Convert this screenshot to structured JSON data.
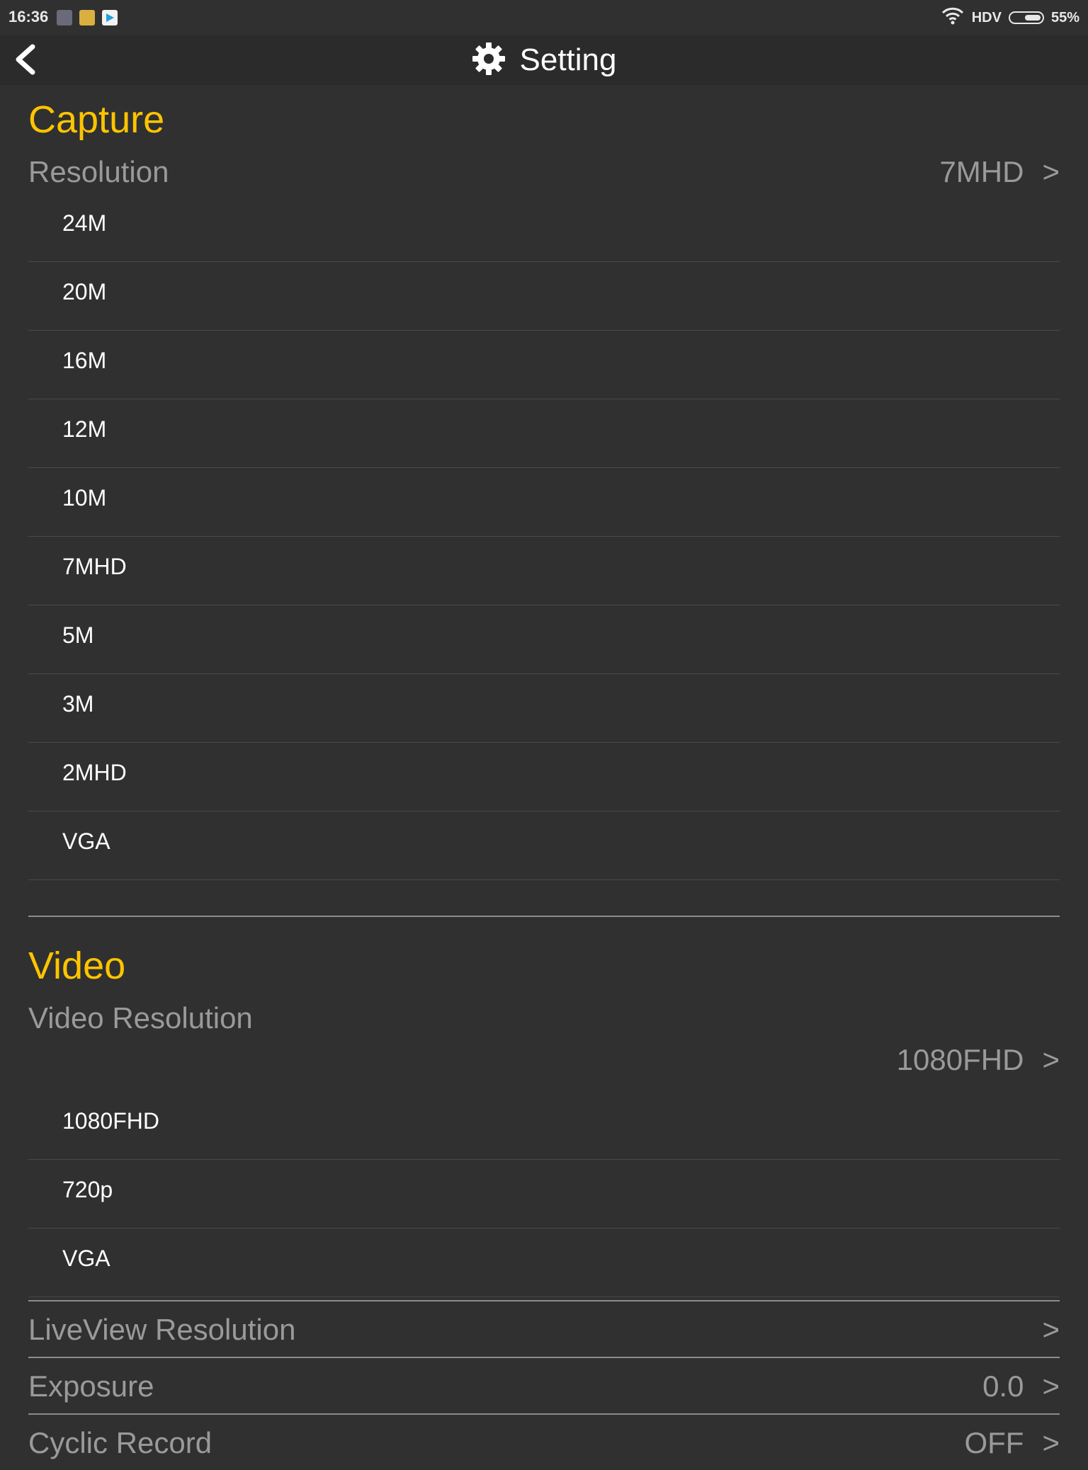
{
  "status_bar": {
    "time": "16:36",
    "network": "HDV",
    "battery": "55%",
    "battery_level": 0.55
  },
  "header": {
    "title": "Setting"
  },
  "capture": {
    "title": "Capture",
    "resolution_label": "Resolution",
    "resolution_value": "7MHD",
    "options": [
      "24M",
      "20M",
      "16M",
      "12M",
      "10M",
      "7MHD",
      "5M",
      "3M",
      "2MHD",
      "VGA"
    ]
  },
  "video": {
    "title": "Video",
    "resolution_label": "Video Resolution",
    "resolution_value": "1080FHD",
    "options": [
      "1080FHD",
      "720p",
      "VGA"
    ]
  },
  "settings": {
    "liveview_label": "LiveView Resolution",
    "liveview_value": "",
    "exposure_label": "Exposure",
    "exposure_value": "0.0",
    "cyclic_label": "Cyclic Record",
    "cyclic_value": "OFF"
  },
  "chevron": ">",
  "colors": {
    "background": "#303030",
    "accent": "#ffc400",
    "label": "#9a9a9a",
    "option_text": "#ffffff"
  }
}
